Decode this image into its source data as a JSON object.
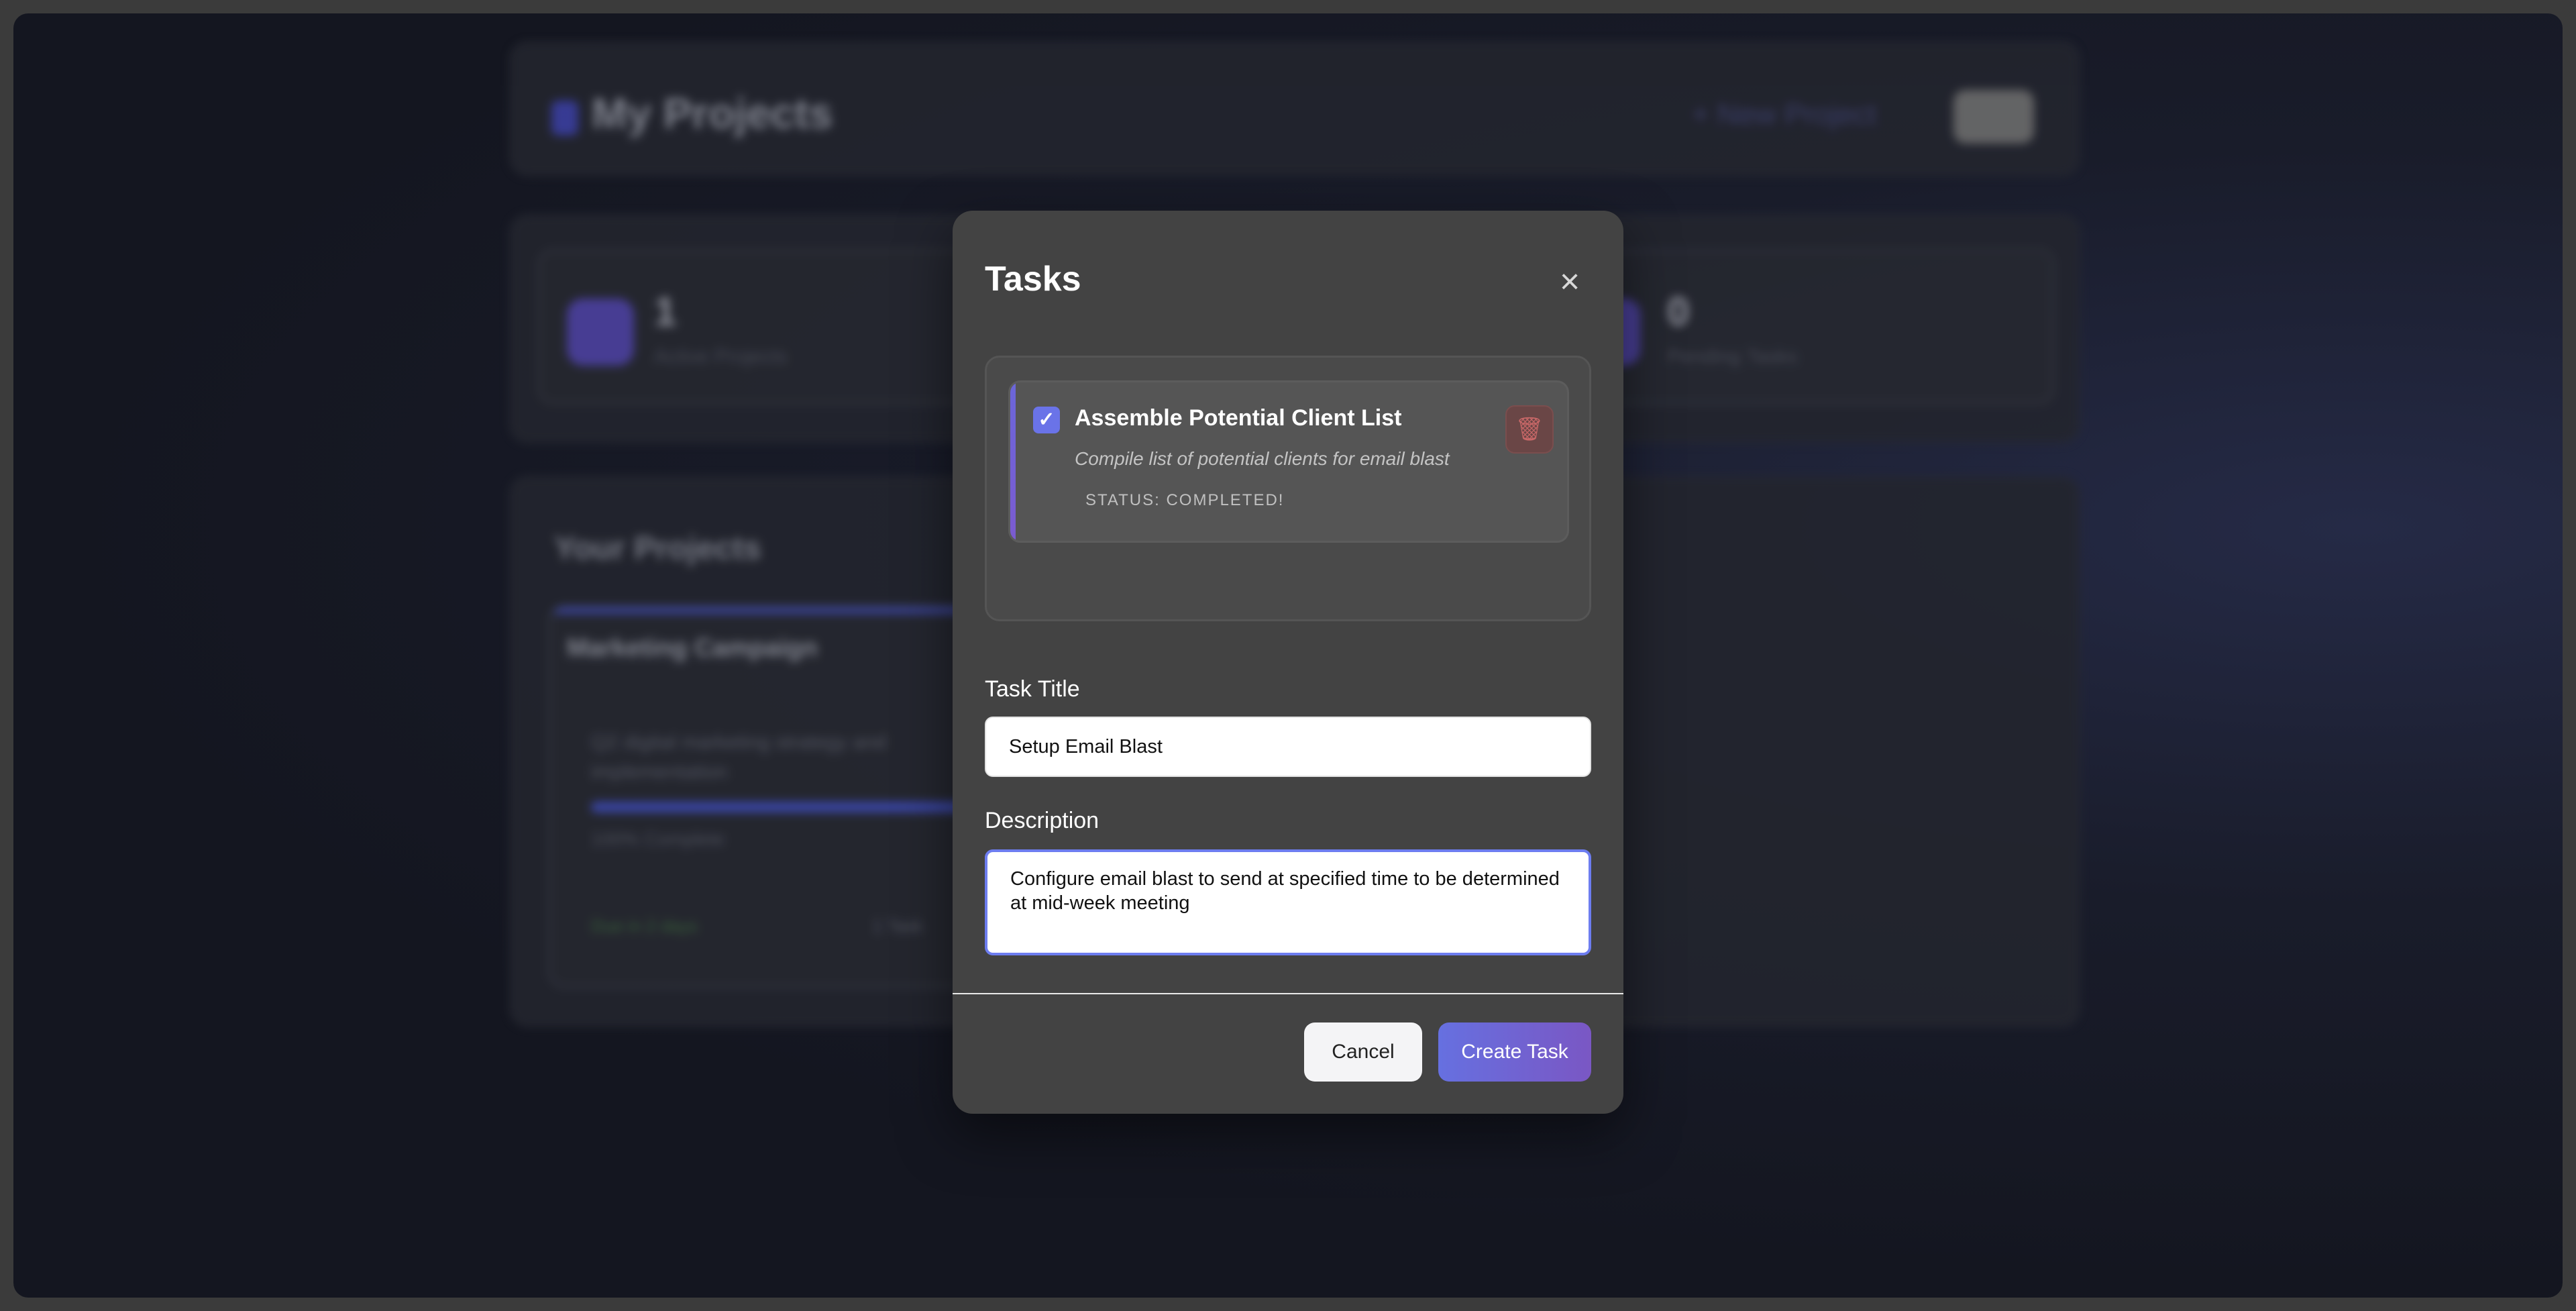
{
  "background": {
    "header": {
      "title": "My Projects",
      "new_project_label": "+ New Project"
    },
    "stats": [
      {
        "value": "1",
        "label": "Active Projects"
      },
      {
        "value": "0",
        "label": "Pending Tasks"
      }
    ],
    "projects_section": {
      "title": "Your Projects",
      "card": {
        "name": "Marketing Campaign",
        "description": "Q2 digital marketing strategy and implementation",
        "progress_label": "100% Complete",
        "due": "Due in 2 days",
        "tasks": "1 Task"
      }
    }
  },
  "modal": {
    "title": "Tasks",
    "close_icon": "×",
    "task": {
      "checked": true,
      "check_glyph": "✓",
      "title": "Assemble Potential Client List",
      "description": "Compile list of potential clients for email blast",
      "status": "STATUS: COMPLETED!",
      "delete_icon": "🗑"
    },
    "form": {
      "title_label": "Task Title",
      "title_value": "Setup Email Blast",
      "description_label": "Description",
      "description_value": "Configure email blast to send at specified time to be determined at mid-week meeting"
    },
    "buttons": {
      "cancel": "Cancel",
      "create": "Create Task"
    }
  },
  "colors": {
    "accent": "#6a73e8",
    "modal_bg": "#434343",
    "create_gradient_end": "#7a57c4"
  }
}
